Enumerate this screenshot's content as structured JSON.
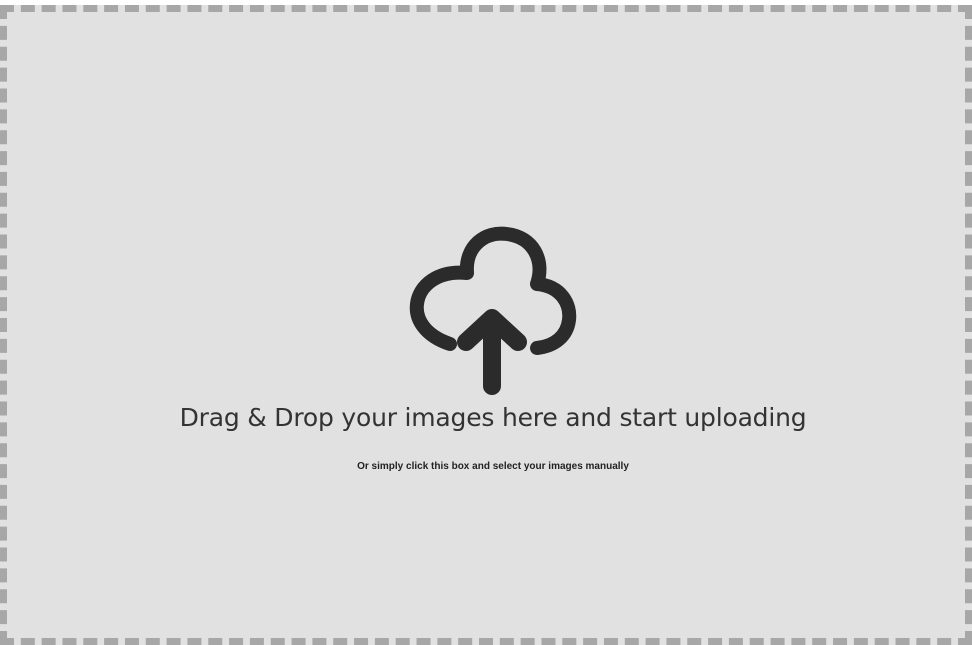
{
  "upload": {
    "icon": "cloud-upload-icon",
    "title": "Drag & Drop your images here and start uploading",
    "subtitle": "Or simply click this box and select your images manually"
  },
  "colors": {
    "background": "#e1e1e1",
    "border": "#a7a7a7",
    "icon": "#2b2b2b",
    "title_text": "#333333"
  }
}
